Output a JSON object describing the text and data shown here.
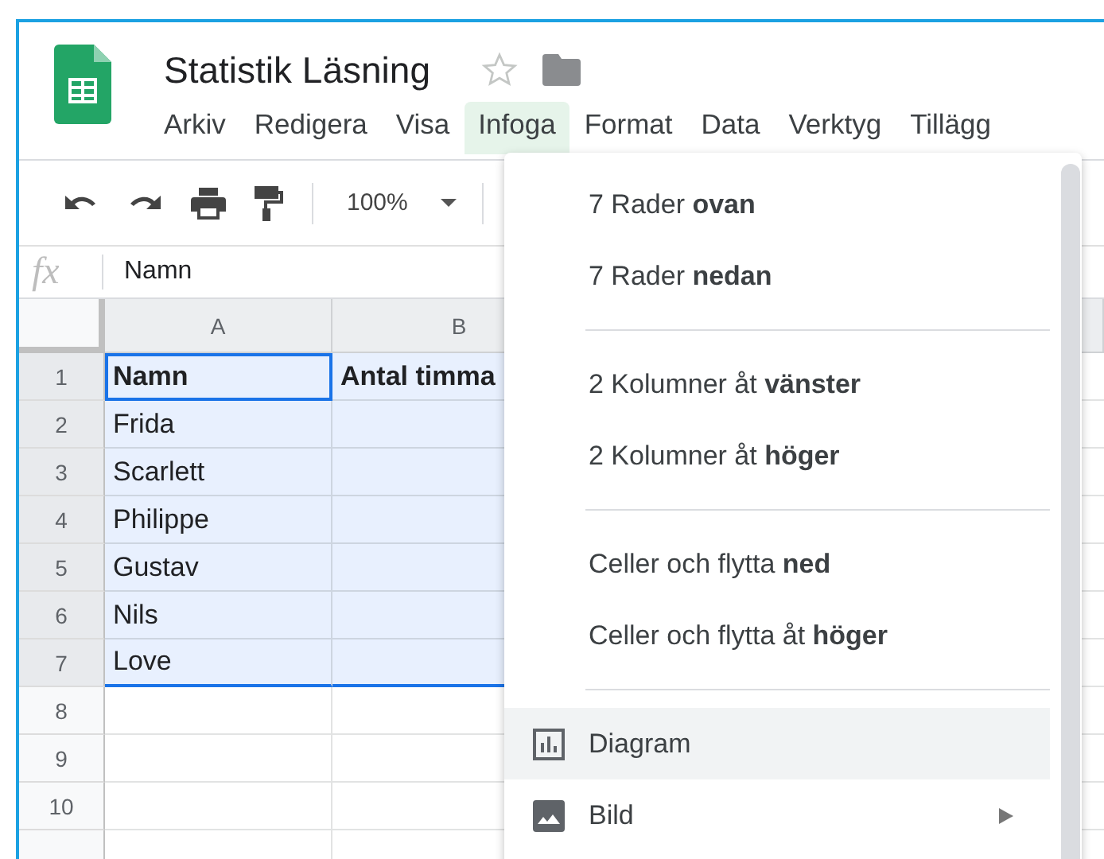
{
  "document": {
    "title": "Statistik Läsning",
    "starred": false
  },
  "menubar": [
    {
      "label": "Arkiv",
      "selected": false
    },
    {
      "label": "Redigera",
      "selected": false
    },
    {
      "label": "Visa",
      "selected": false
    },
    {
      "label": "Infoga",
      "selected": true
    },
    {
      "label": "Format",
      "selected": false
    },
    {
      "label": "Data",
      "selected": false
    },
    {
      "label": "Verktyg",
      "selected": false
    },
    {
      "label": "Tillägg",
      "selected": false
    }
  ],
  "toolbar": {
    "zoom": "100%"
  },
  "formula_bar": {
    "label": "fx",
    "value": "Namn"
  },
  "grid": {
    "columns": [
      {
        "label": "A"
      },
      {
        "label": "B"
      }
    ],
    "rows": [
      {
        "label": "1",
        "selected": true,
        "bold": true,
        "cells": [
          {
            "text": "Namn",
            "active": true
          },
          {
            "text": "Antal timma",
            "active": false
          }
        ]
      },
      {
        "label": "2",
        "selected": true,
        "bold": false,
        "cells": [
          {
            "text": "Frida",
            "active": false
          },
          {
            "active": false
          }
        ]
      },
      {
        "label": "3",
        "selected": true,
        "bold": false,
        "cells": [
          {
            "text": "Scarlett",
            "active": false
          },
          {
            "active": false
          }
        ]
      },
      {
        "label": "4",
        "selected": true,
        "bold": false,
        "cells": [
          {
            "text": "Philippe",
            "active": false
          },
          {
            "active": false
          }
        ]
      },
      {
        "label": "5",
        "selected": true,
        "bold": false,
        "cells": [
          {
            "text": "Gustav",
            "active": false
          },
          {
            "active": false
          }
        ]
      },
      {
        "label": "6",
        "selected": true,
        "bold": false,
        "cells": [
          {
            "text": "Nils",
            "active": false
          },
          {
            "active": false
          }
        ]
      },
      {
        "label": "7",
        "selected": true,
        "bold": false,
        "cells": [
          {
            "text": "Love",
            "active": false
          },
          {
            "active": false
          }
        ]
      },
      {
        "label": "8",
        "selected": false,
        "cells": [
          {
            "active": false
          },
          {
            "active": false
          }
        ]
      },
      {
        "label": "9",
        "selected": false,
        "cells": [
          {
            "active": false
          },
          {
            "active": false
          }
        ]
      },
      {
        "label": "10",
        "selected": false,
        "cells": [
          {
            "active": false
          },
          {
            "active": false
          }
        ]
      }
    ]
  },
  "insert_menu": [
    {
      "kind": "item",
      "label": "7 Rader **ovan**",
      "selected": false
    },
    {
      "kind": "item",
      "label": "7 Rader **nedan**",
      "selected": false
    },
    {
      "kind": "separator"
    },
    {
      "kind": "item",
      "label": "2 Kolumner åt **vänster**",
      "selected": false
    },
    {
      "kind": "item",
      "label": "2 Kolumner åt **höger**",
      "selected": false
    },
    {
      "kind": "separator"
    },
    {
      "kind": "item",
      "label": "Celler och flytta **ned**",
      "selected": false
    },
    {
      "kind": "item",
      "label": "Celler och flytta åt **höger**",
      "selected": false
    },
    {
      "kind": "separator"
    },
    {
      "kind": "chart",
      "label": "Diagram",
      "selected": true
    },
    {
      "kind": "image",
      "label": "Bild",
      "selected": false,
      "submenu": true
    }
  ]
}
